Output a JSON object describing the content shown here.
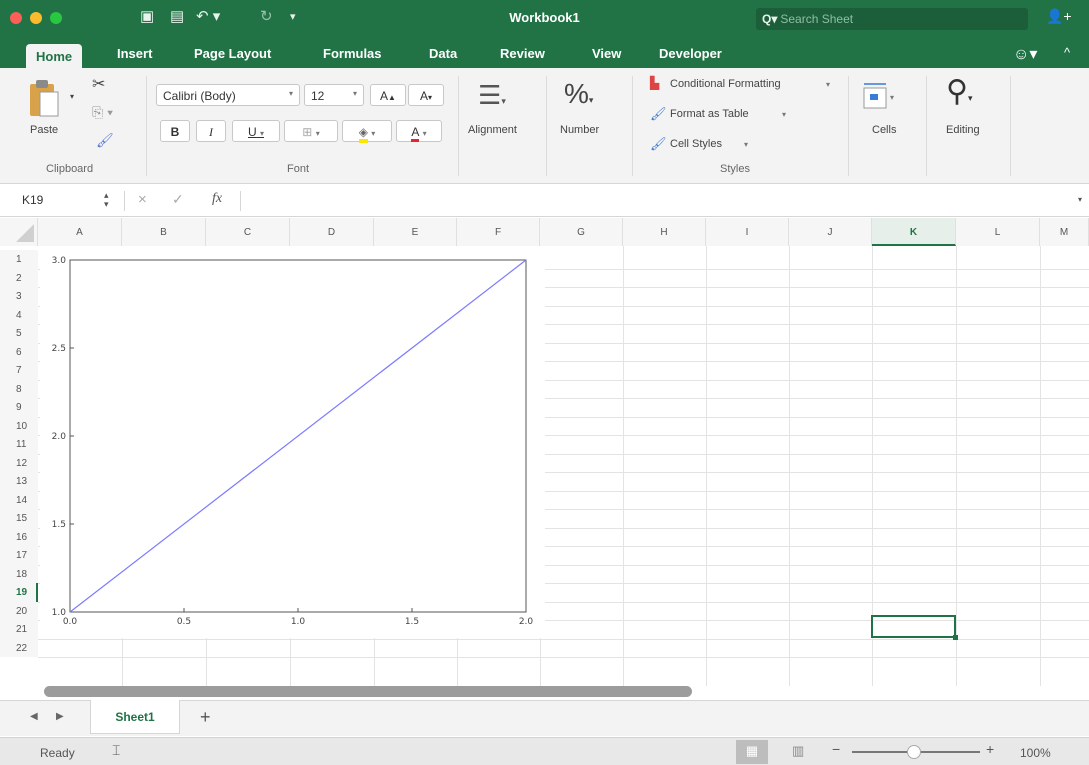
{
  "window": {
    "title": "Workbook1",
    "search_placeholder": "Search Sheet"
  },
  "tabs": [
    "Home",
    "Insert",
    "Page Layout",
    "Formulas",
    "Data",
    "Review",
    "View",
    "Developer"
  ],
  "ribbon": {
    "clipboard": {
      "paste_label": "Paste",
      "group_label": "Clipboard"
    },
    "font": {
      "family": "Calibri (Body)",
      "size": "12",
      "bold": "B",
      "italic": "I",
      "underline": "U",
      "grow": "A",
      "shrink": "A",
      "font_color": "A",
      "group_label": "Font"
    },
    "alignment_label": "Alignment",
    "number_label": "Number",
    "styles": {
      "conditional": "Conditional Formatting",
      "format_table": "Format as Table",
      "cell_styles": "Cell Styles",
      "group_label": "Styles"
    },
    "cells_label": "Cells",
    "editing_label": "Editing"
  },
  "formula_bar": {
    "name_box": "K19",
    "fx": "fx",
    "value": ""
  },
  "columns": [
    "A",
    "B",
    "C",
    "D",
    "E",
    "F",
    "G",
    "H",
    "I",
    "J",
    "K",
    "L",
    "M"
  ],
  "rows": [
    "1",
    "2",
    "3",
    "4",
    "5",
    "6",
    "7",
    "8",
    "9",
    "10",
    "11",
    "12",
    "13",
    "14",
    "15",
    "16",
    "17",
    "18",
    "19",
    "20",
    "21",
    "22"
  ],
  "selected": {
    "column": "K",
    "row": "19"
  },
  "chart_data": {
    "type": "line",
    "x": [
      0.0,
      2.0
    ],
    "series": [
      {
        "values": [
          1.0,
          3.0
        ],
        "color": "#7b7bff"
      }
    ],
    "xlim": [
      0.0,
      2.0
    ],
    "ylim": [
      1.0,
      3.0
    ],
    "xticks": [
      "0.0",
      "0.5",
      "1.0",
      "1.5",
      "2.0"
    ],
    "yticks": [
      "1.0",
      "1.5",
      "2.0",
      "2.5",
      "3.0"
    ],
    "grid": false
  },
  "sheets": {
    "active": "Sheet1",
    "add": "+"
  },
  "status": {
    "ready": "Ready",
    "zoom": "100%"
  },
  "colors": {
    "brand": "#217346",
    "line": "#7b7bff"
  }
}
